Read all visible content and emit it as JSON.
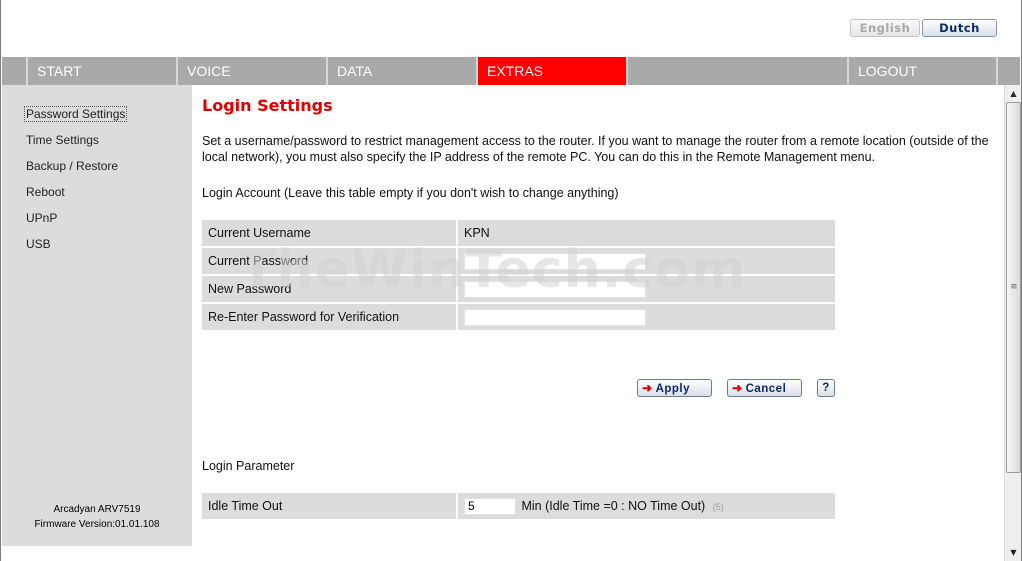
{
  "lang": {
    "english": "English",
    "dutch": "Dutch"
  },
  "nav": {
    "start": "START",
    "voice": "VOICE",
    "data": "DATA",
    "extras": "EXTRAS",
    "logout": "LOGOUT"
  },
  "sidebar": {
    "items": [
      "Password Settings",
      "Time Settings",
      "Backup / Restore",
      "Reboot",
      "UPnP",
      "USB"
    ],
    "device": "Arcadyan ARV7519",
    "firmware": "Firmware Version:01.01.108"
  },
  "main": {
    "title": "Login Settings",
    "intro": "Set a username/password to restrict management access to the router. If you want to manage the router from a remote location (outside of the local network), you must also specify the IP address of the remote PC. You can do this in the Remote Management menu.",
    "login_account_label": "Login Account (Leave this table empty if you don't wish to change anything)",
    "rows": {
      "current_username_label": "Current Username",
      "current_username_value": "KPN",
      "current_password_label": "Current Password",
      "new_password_label": "New Password",
      "reenter_label": "Re-Enter Password for Verification"
    },
    "buttons": {
      "apply": "Apply",
      "cancel": "Cancel",
      "help": "?"
    },
    "login_parameter_label": "Login Parameter",
    "idle": {
      "label": "Idle Time Out",
      "value": "5",
      "hint": "Min (Idle Time =0 : NO Time Out)",
      "note": "(5)"
    }
  },
  "watermark": "TheWinTech.com"
}
